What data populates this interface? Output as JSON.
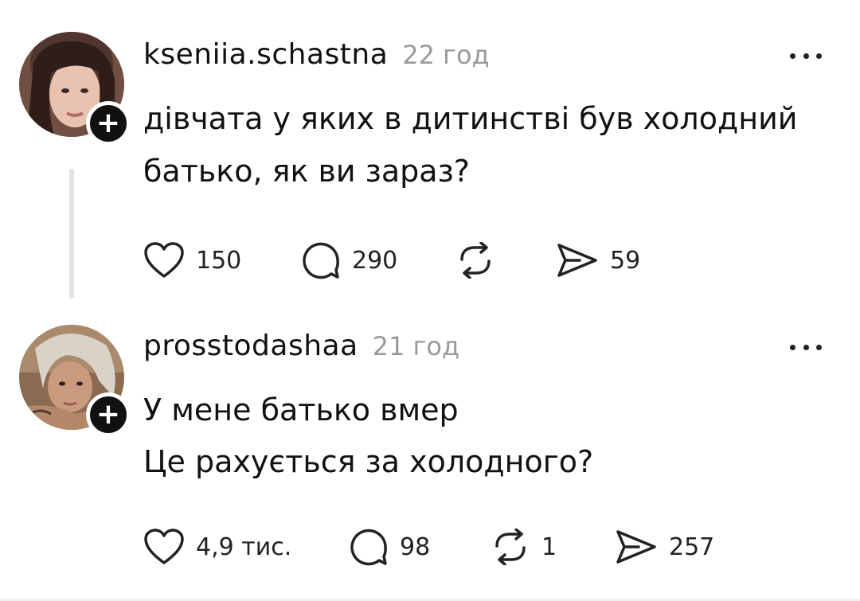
{
  "posts": [
    {
      "username": "kseniia.schastna",
      "time": "22 год",
      "text_lines": [
        "дівчата у яких в дитинстві був холодний",
        "батько, як ви зараз?"
      ],
      "likes": "150",
      "comments": "290",
      "reposts": "",
      "shares": "59",
      "follow_symbol": "+"
    },
    {
      "username": "prosstodashaa",
      "time": "21 год",
      "text_lines": [
        "У мене батько вмер",
        "Це рахується за холодного?"
      ],
      "likes": "4,9 тис.",
      "comments": "98",
      "reposts": "1",
      "shares": "257",
      "follow_symbol": "+"
    }
  ],
  "icons": {
    "like": "heart-icon",
    "comment": "comment-icon",
    "repost": "repost-icon",
    "share": "share-icon",
    "more": "more-icon"
  },
  "colors": {
    "text": "#111111",
    "muted": "#9a9a9a",
    "thread_line": "#e3e3e3"
  }
}
